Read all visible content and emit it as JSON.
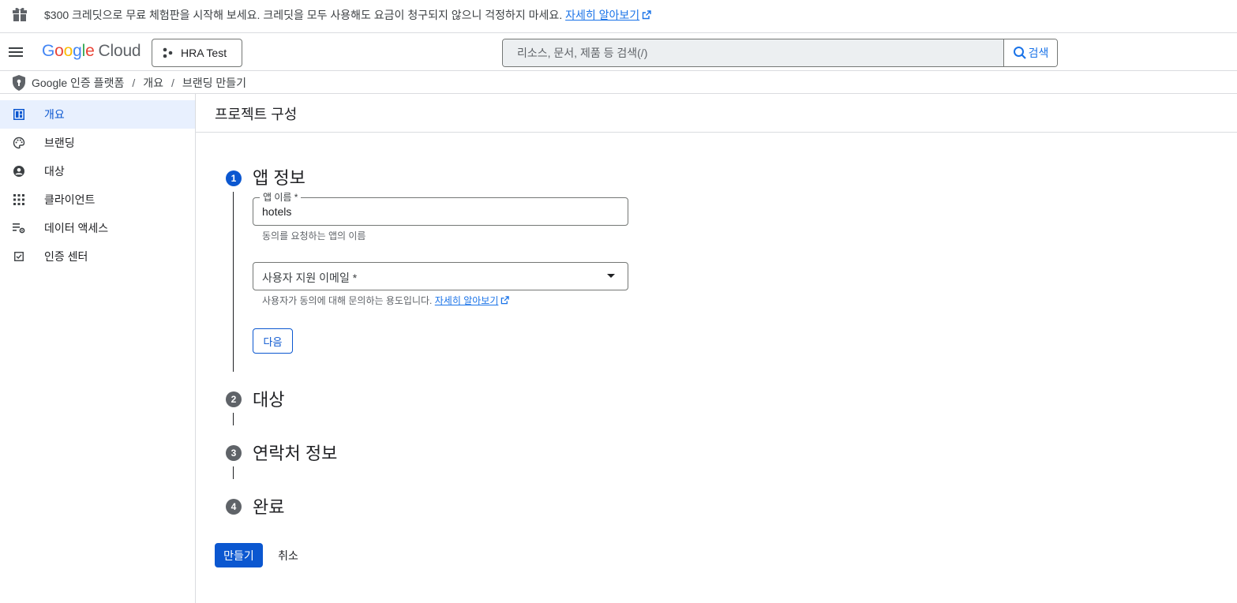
{
  "banner": {
    "text": "$300 크레딧으로 무료 체험판을 시작해 보세요. 크레딧을 모두 사용해도 요금이 청구되지 않으니 걱정하지 마세요.",
    "link": "자세히 알아보기"
  },
  "header": {
    "logo_letters": [
      "G",
      "o",
      "o",
      "g",
      "l",
      "e"
    ],
    "logo_cloud": "Cloud",
    "project_name": "HRA Test",
    "search_placeholder": "리소스, 문서, 제품 등 검색(/)",
    "search_button": "검색"
  },
  "breadcrumb": {
    "items": [
      "Google 인증 플랫폼",
      "개요",
      "브랜딩 만들기"
    ],
    "separator": "/"
  },
  "sidebar": {
    "items": [
      {
        "label": "개요",
        "icon": "dashboard-icon",
        "active": true
      },
      {
        "label": "브랜딩",
        "icon": "palette-icon",
        "active": false
      },
      {
        "label": "대상",
        "icon": "account-circle-icon",
        "active": false
      },
      {
        "label": "클라이언트",
        "icon": "apps-grid-icon",
        "active": false
      },
      {
        "label": "데이터 액세스",
        "icon": "list-settings-icon",
        "active": false
      },
      {
        "label": "인증 센터",
        "icon": "checkbox-icon",
        "active": false
      }
    ]
  },
  "main": {
    "title": "프로젝트 구성",
    "steps": [
      {
        "number": "1",
        "title": "앱 정보",
        "active": true
      },
      {
        "number": "2",
        "title": "대상",
        "active": false
      },
      {
        "number": "3",
        "title": "연락처 정보",
        "active": false
      },
      {
        "number": "4",
        "title": "완료",
        "active": false
      }
    ],
    "app_name": {
      "label": "앱 이름 *",
      "value": "hotels",
      "hint": "동의를 요청하는 앱의 이름"
    },
    "support_email": {
      "placeholder": "사용자 지원 이메일 *",
      "hint": "사용자가 동의에 대해 문의하는 용도입니다.",
      "hint_link": "자세히 알아보기"
    },
    "next_button": "다음",
    "create_button": "만들기",
    "cancel_button": "취소"
  },
  "colors": {
    "accent": "#0b57d0",
    "active_nav_bg": "#e8f0fe",
    "link": "#1a73e8",
    "divider": "#dadce0"
  }
}
